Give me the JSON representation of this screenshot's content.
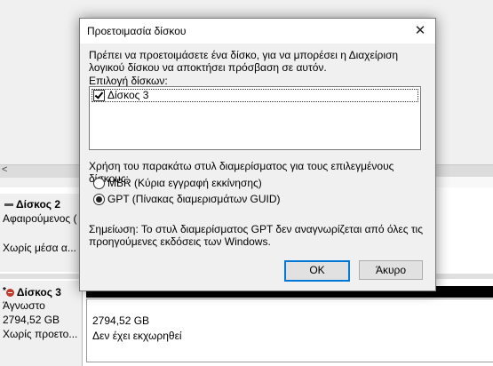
{
  "background": {
    "left_arrow": "<",
    "disk2": {
      "title": "Δίσκος 2",
      "line1": "Αφαιρούμενος (",
      "line2": "Χωρίς μέσα α..."
    },
    "disk3": {
      "star": "*",
      "title": "Δίσκος 3",
      "line1": "Άγνωστο",
      "line2": "2794,52 GB",
      "line3": "Χωρίς προετο..."
    },
    "unallocated": {
      "size": "2794,52 GB",
      "status": "Δεν έχει εκχωρηθεί"
    }
  },
  "dialog": {
    "title": "Προετοιμασία δίσκου",
    "close_glyph": "✕",
    "message": "Πρέπει να προετοιμάσετε ένα δίσκο, για να μπορέσει η Διαχείριση λογικού δίσκου να αποκτήσει πρόσβαση σε αυτόν.",
    "select_label": "Επιλογή δίσκων:",
    "disks": [
      {
        "label": "Δίσκος 3",
        "checked": true
      }
    ],
    "style_question": "Χρήση του παρακάτω στυλ διαμερίσματος για τους επιλεγμένους δίσκους:",
    "options": [
      {
        "label": "MBR (Κύρια εγγραφή εκκίνησης)",
        "selected": false
      },
      {
        "label": "GPT (Πίνακας διαμερισμάτων GUID)",
        "selected": true
      }
    ],
    "note": "Σημείωση: Το στυλ διαμερίσματος GPT δεν αναγνωρίζεται από όλες τις προηγούμενες εκδόσεις των Windows.",
    "ok_label": "OK",
    "cancel_label": "Άκυρο"
  },
  "colors": {
    "accent": "#0078d7",
    "error_icon": "#c0392b"
  }
}
